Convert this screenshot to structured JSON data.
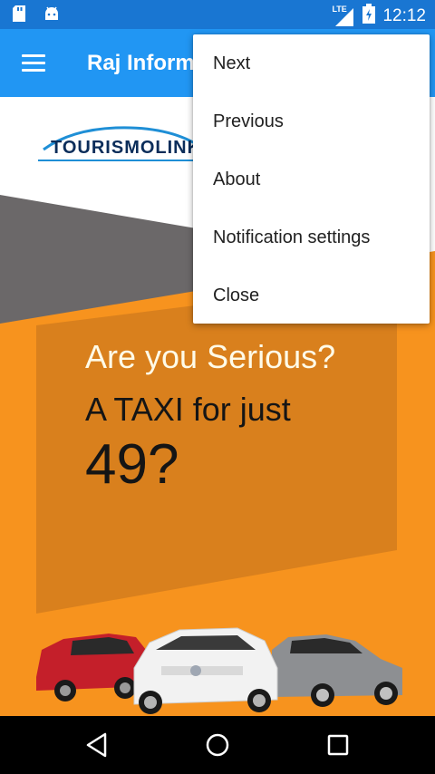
{
  "status_bar": {
    "time": "12:12",
    "network": "LTE",
    "icons": [
      "sd-card-icon",
      "android-icon",
      "signal-icon",
      "battery-icon"
    ]
  },
  "toolbar": {
    "title": "Raj Information",
    "menu_icon": "hamburger-icon"
  },
  "logo": {
    "text": "TOURISMOLINK"
  },
  "banner": {
    "line1": "Are you Serious?",
    "line2": "A TAXI for just",
    "line3": "49?"
  },
  "menu": {
    "items": [
      {
        "label": "Next"
      },
      {
        "label": "Previous"
      },
      {
        "label": "About"
      },
      {
        "label": "Notification settings"
      },
      {
        "label": "Close"
      }
    ]
  },
  "nav_bar": {
    "buttons": [
      "back-icon",
      "home-icon",
      "recents-icon"
    ]
  },
  "colors": {
    "status_bar": "#1976d2",
    "toolbar": "#2196f3",
    "banner_orange": "#f7931e",
    "banner_dark_orange": "#d9801d",
    "banner_grey": "#6b6869"
  }
}
